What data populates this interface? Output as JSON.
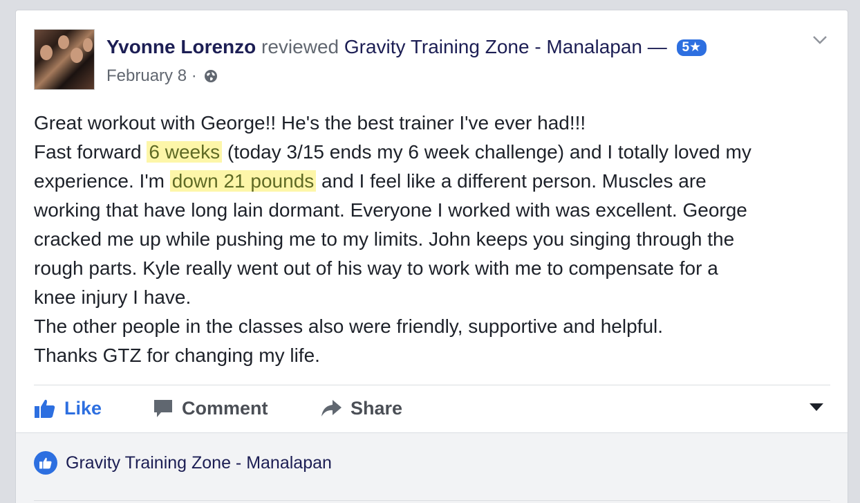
{
  "post": {
    "author": "Yvonne Lorenzo",
    "action_text": "reviewed",
    "page_name": "Gravity Training Zone - Manalapan",
    "dash": "—",
    "rating": "5★",
    "date": "February 8",
    "separator": "·",
    "privacy_icon": "globe-icon",
    "menu_icon": "chevron-down-icon"
  },
  "review": {
    "line1": "Great workout with George!! He's the best trainer I've ever had!!!",
    "line2_pre": "Fast forward ",
    "line2_hl": "6 weeks",
    "line2_post": " (today 3/15 ends my 6 week challenge) and I totally loved my",
    "line3_pre": "experience. I'm ",
    "line3_hl": "down 21 pounds",
    "line3_post": " and I feel like a different person. Muscles are",
    "line4": "working that have long lain dormant. Everyone I worked with was excellent. George",
    "line5": "cracked me up while pushing me to my limits. John keeps you singing through the",
    "line6": "rough parts. Kyle really went out of his way to work with me to compensate for a",
    "line7": "knee injury I have.",
    "line8": "The other people in the classes also were friendly, supportive and helpful.",
    "line9": "Thanks GTZ for changing my life."
  },
  "actions": {
    "like": "Like",
    "comment": "Comment",
    "share": "Share"
  },
  "footer": {
    "liked_by": "Gravity Training Zone - Manalapan"
  },
  "colors": {
    "accent": "#2d6fe0",
    "highlight": "#fdf6a9",
    "author": "#1c1e54"
  }
}
